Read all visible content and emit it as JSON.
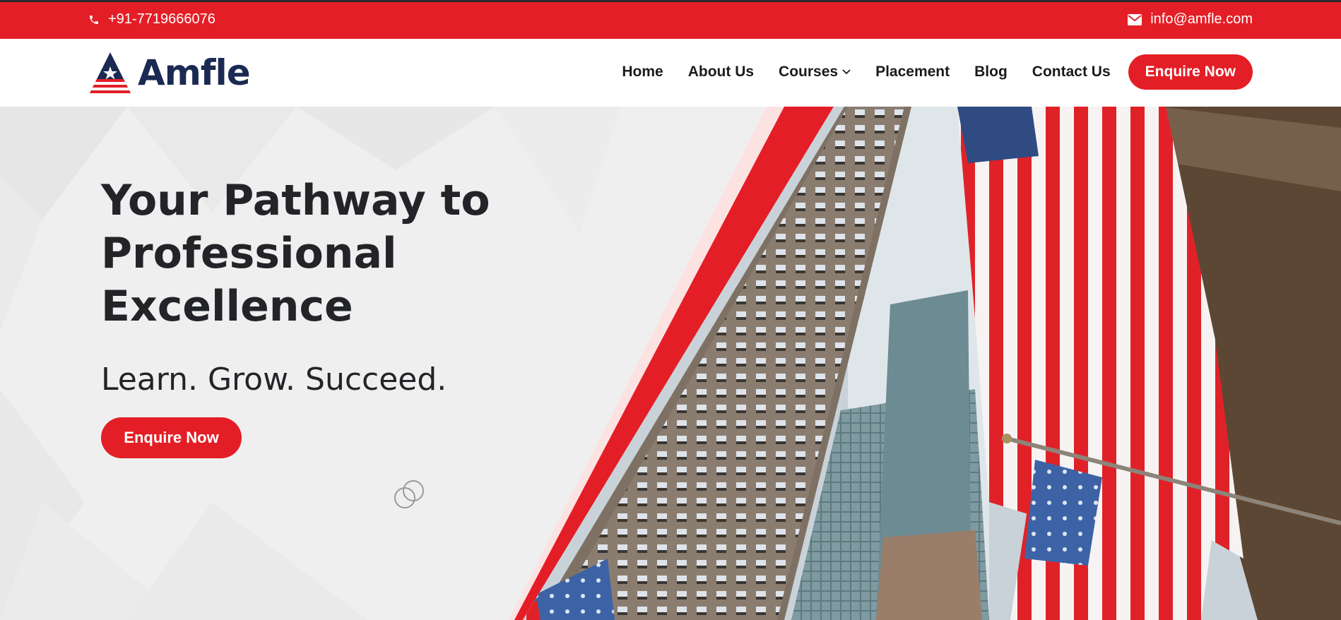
{
  "topbar": {
    "phone": "+91-7719666076",
    "email": "info@amfle.com",
    "phone_icon": "phone-icon",
    "email_icon": "envelope-icon"
  },
  "brand": {
    "name": "Amfle"
  },
  "nav": {
    "items": [
      {
        "label": "Home"
      },
      {
        "label": "About Us"
      },
      {
        "label": "Courses"
      },
      {
        "label": "Placement"
      },
      {
        "label": "Blog"
      },
      {
        "label": "Contact Us"
      }
    ],
    "cta": "Enquire Now"
  },
  "hero": {
    "title": "Your Pathway to Professional Excellence",
    "subtitle": "Learn. Grow. Succeed.",
    "cta": "Enquire Now"
  },
  "colors": {
    "accent": "#e41e26",
    "brand_navy": "#1a2a52",
    "text_dark": "#222428",
    "hero_bg": "#efefef"
  }
}
